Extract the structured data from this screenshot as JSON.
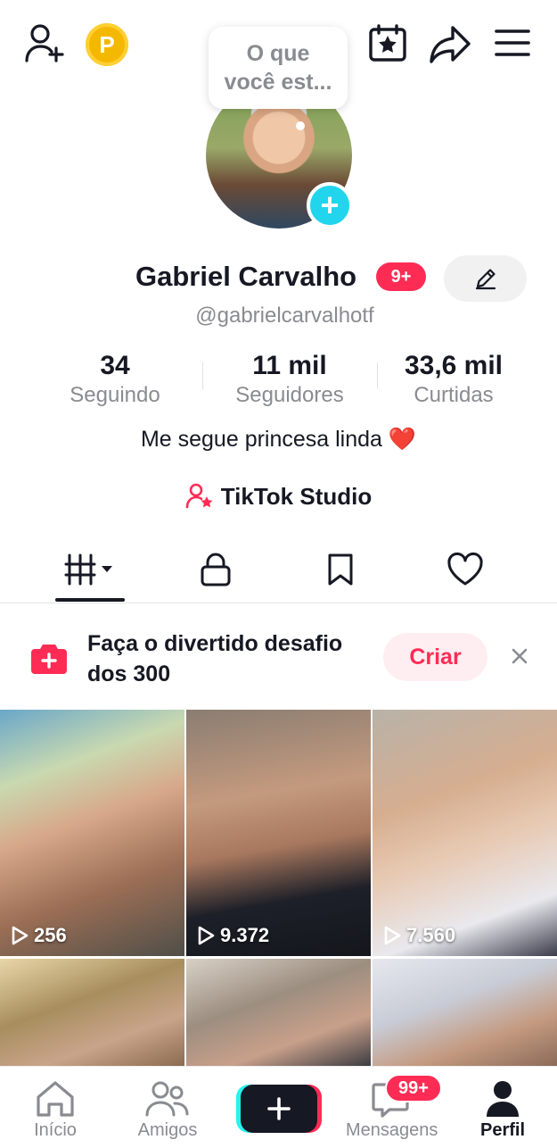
{
  "header": {
    "add_friend_icon": "person-plus-icon",
    "coin_label": "P",
    "calendar_icon": "calendar-star-icon",
    "share_icon": "share-arrow-icon",
    "menu_icon": "hamburger-menu-icon"
  },
  "status_bubble": {
    "line1": "O que",
    "line2": "você est..."
  },
  "profile": {
    "name": "Gabriel Carvalho",
    "badge": "9+",
    "username": "@gabrielcarvalhotf",
    "bio": "Me segue princesa linda ❤️",
    "studio_label": "TikTok Studio"
  },
  "stats": [
    {
      "value": "34",
      "label": "Seguindo"
    },
    {
      "value": "11 mil",
      "label": "Seguidores"
    },
    {
      "value": "33,6 mil",
      "label": "Curtidas"
    }
  ],
  "tabs": [
    "videos-grid",
    "private",
    "saved",
    "liked"
  ],
  "challenge": {
    "text": "Faça o divertido desafio dos 300",
    "button": "Criar"
  },
  "videos": [
    {
      "views": "256"
    },
    {
      "views": "9.372"
    },
    {
      "views": "7.560"
    },
    {
      "views": ""
    },
    {
      "views": ""
    },
    {
      "views": ""
    }
  ],
  "nav": {
    "home": "Início",
    "friends": "Amigos",
    "messages": "Mensagens",
    "messages_badge": "99+",
    "profile": "Perfil"
  },
  "colors": {
    "accent": "#fe2c55",
    "cyan": "#25f4ee",
    "text": "#161823",
    "muted": "#8a8b91"
  }
}
